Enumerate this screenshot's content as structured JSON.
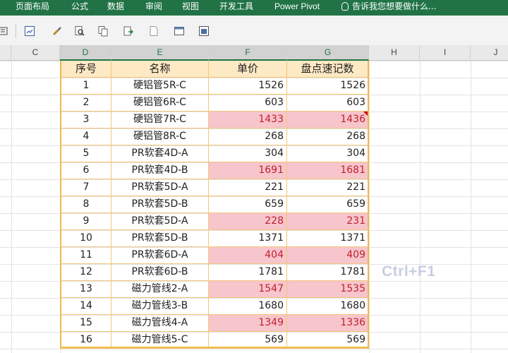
{
  "ribbon": {
    "tabs": [
      "页面布局",
      "公式",
      "数据",
      "审阅",
      "视图",
      "开发工具",
      "Power Pivot"
    ],
    "tell_me": "告诉我您想要做什么..."
  },
  "toolbar": {
    "icons": [
      "sort-icon",
      "refresh-icon",
      "brush-icon",
      "zoom-icon",
      "copy-icon",
      "paste-icon",
      "file-icon",
      "window-icon",
      "save-icon"
    ]
  },
  "columns": [
    "C",
    "D",
    "E",
    "F",
    "G",
    "H",
    "I",
    "J"
  ],
  "table": {
    "headers": [
      "序号",
      "名称",
      "单价",
      "盘点速记数"
    ],
    "rows": [
      {
        "no": "1",
        "name": "硬铝管5R-C",
        "price": "1526",
        "count": "1526",
        "diff": false
      },
      {
        "no": "2",
        "name": "硬铝管6R-C",
        "price": "603",
        "count": "603",
        "diff": false
      },
      {
        "no": "3",
        "name": "硬铝管7R-C",
        "price": "1433",
        "count": "1436",
        "diff": true,
        "comment": true
      },
      {
        "no": "4",
        "name": "硬铝管8R-C",
        "price": "268",
        "count": "268",
        "diff": false
      },
      {
        "no": "5",
        "name": "PR软套4D-A",
        "price": "304",
        "count": "304",
        "diff": false
      },
      {
        "no": "6",
        "name": "PR软套4D-B",
        "price": "1691",
        "count": "1681",
        "diff": true
      },
      {
        "no": "7",
        "name": "PR软套5D-A",
        "price": "221",
        "count": "221",
        "diff": false
      },
      {
        "no": "8",
        "name": "PR软套5D-B",
        "price": "659",
        "count": "659",
        "diff": false
      },
      {
        "no": "9",
        "name": "PR软套5D-A",
        "price": "228",
        "count": "231",
        "diff": true
      },
      {
        "no": "10",
        "name": "PR软套5D-B",
        "price": "1371",
        "count": "1371",
        "diff": false
      },
      {
        "no": "11",
        "name": "PR软套6D-A",
        "price": "404",
        "count": "409",
        "diff": true
      },
      {
        "no": "12",
        "name": "PR软套6D-B",
        "price": "1781",
        "count": "1781",
        "diff": false
      },
      {
        "no": "13",
        "name": "磁力管线2-A",
        "price": "1547",
        "count": "1535",
        "diff": true
      },
      {
        "no": "14",
        "name": "磁力管线3-B",
        "price": "1680",
        "count": "1680",
        "diff": false
      },
      {
        "no": "15",
        "name": "磁力管线4-A",
        "price": "1349",
        "count": "1336",
        "diff": true
      },
      {
        "no": "16",
        "name": "磁力管线5-C",
        "price": "569",
        "count": "569",
        "diff": false
      }
    ]
  },
  "overlay": {
    "shortcut": "Ctrl+F1"
  },
  "colors": {
    "ribbon": "#217346",
    "header_fill": "#fde9c4",
    "diff_fill": "#f7c5cc",
    "diff_text": "#c0212f",
    "border": "#f2b84a"
  }
}
